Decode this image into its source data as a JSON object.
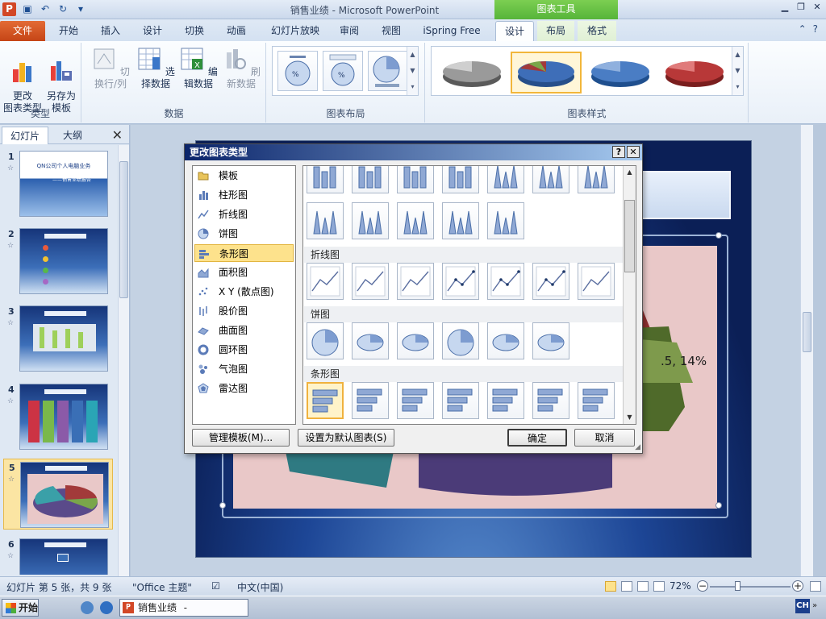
{
  "window": {
    "title": "销售业绩 - Microsoft PowerPoint",
    "contextual_tab_group": "图表工具"
  },
  "ribbon_tabs": [
    {
      "label": "文件"
    },
    {
      "label": "开始"
    },
    {
      "label": "插入"
    },
    {
      "label": "设计"
    },
    {
      "label": "切换"
    },
    {
      "label": "动画"
    },
    {
      "label": "幻灯片放映"
    },
    {
      "label": "审阅"
    },
    {
      "label": "视图"
    },
    {
      "label": "iSpring Free"
    },
    {
      "label": "设计"
    },
    {
      "label": "布局"
    },
    {
      "label": "格式"
    }
  ],
  "ribbon": {
    "type_group": {
      "label": "类型",
      "change_type": "更改\n图表类型",
      "save_template": "另存为\n模板"
    },
    "data_group": {
      "label": "数据",
      "switch_row_col": "切换行/列",
      "select_data": "选择数据",
      "edit_data": "编辑数据",
      "refresh_data": "刷新数据"
    },
    "layout_group": {
      "label": "图表布局"
    },
    "style_group": {
      "label": "图表样式"
    }
  },
  "left_panel": {
    "tabs": [
      {
        "label": "幻灯片"
      },
      {
        "label": "大纲"
      }
    ],
    "slides": [
      {
        "num": "1",
        "title": "QN公司个人电脑业务",
        "subtitle": "——销售业绩报告"
      },
      {
        "num": "2"
      },
      {
        "num": "3"
      },
      {
        "num": "4"
      },
      {
        "num": "5"
      },
      {
        "num": "6"
      }
    ],
    "current_slide": 5
  },
  "slide": {
    "data_label": ".5, 14%"
  },
  "dialog": {
    "title": "更改图表类型",
    "types": [
      {
        "label": "模板"
      },
      {
        "label": "柱形图"
      },
      {
        "label": "折线图"
      },
      {
        "label": "饼图"
      },
      {
        "label": "条形图"
      },
      {
        "label": "面积图"
      },
      {
        "label": "X Y (散点图)"
      },
      {
        "label": "股价图"
      },
      {
        "label": "曲面图"
      },
      {
        "label": "圆环图"
      },
      {
        "label": "气泡图"
      },
      {
        "label": "雷达图"
      }
    ],
    "selected_type": "条形图",
    "sections": {
      "line": "折线图",
      "pie": "饼图",
      "bar": "条形图"
    },
    "manage_templates": "管理模板(M)...",
    "set_default": "设置为默认图表(S)",
    "ok": "确定",
    "cancel": "取消"
  },
  "statusbar": {
    "slide_info": "幻灯片 第 5 张，共 9 张",
    "theme": "\"Office 主题\"",
    "language": "中文(中国)",
    "zoom": "72%"
  },
  "taskbar": {
    "start": "开始",
    "app": "销售业绩 - Microsof...",
    "ime": "CH"
  },
  "colors": {
    "file_tab": "#c54516",
    "context_green": "#56b43a",
    "dialog_title": "#0a246a",
    "selection": "#fde28c"
  }
}
